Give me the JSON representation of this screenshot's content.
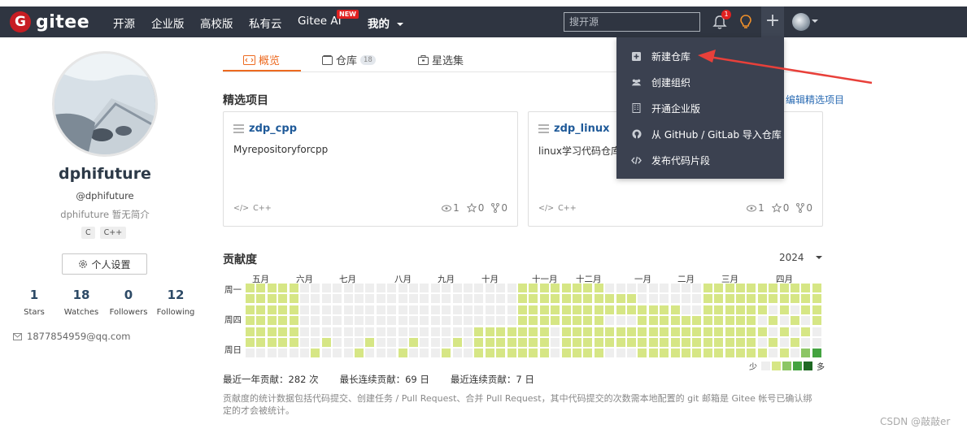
{
  "brand": {
    "logo_letter": "G",
    "name": "gitee"
  },
  "nav": {
    "items": [
      "开源",
      "企业版",
      "高校版",
      "私有云",
      "Gitee AI",
      "我的"
    ],
    "new_badge": "NEW",
    "search_placeholder": "搜开源",
    "notification_count": "1"
  },
  "profile": {
    "name": "dphifuture",
    "handle": "@dphifuture",
    "bio": "dphifuture 暂无简介",
    "languages": [
      "C",
      "C++"
    ],
    "settings_label": "个人设置",
    "stats": [
      {
        "value": "1",
        "label": "Stars"
      },
      {
        "value": "18",
        "label": "Watches"
      },
      {
        "value": "0",
        "label": "Followers"
      },
      {
        "value": "12",
        "label": "Following"
      }
    ],
    "email": "1877854959@qq.com"
  },
  "tabs": [
    {
      "label": "概览",
      "count": ""
    },
    {
      "label": "仓库",
      "count": "18"
    },
    {
      "label": "星选集",
      "count": ""
    }
  ],
  "featured": {
    "title": "精选项目",
    "edit_label": "编辑精选项目",
    "projects": [
      {
        "name": "zdp_cpp",
        "description": "Myrepositoryforcpp",
        "language": "C++",
        "watches": "1",
        "stars": "0",
        "forks": "0"
      },
      {
        "name": "zdp_linux",
        "description": "linux学习代码仓库",
        "language": "C++",
        "watches": "1",
        "stars": "0",
        "forks": "0"
      }
    ]
  },
  "contribution": {
    "title": "贡献度",
    "year": "2024",
    "months": [
      "五月",
      "六月",
      "七月",
      "八月",
      "九月",
      "十月",
      "十一月",
      "十二月",
      "一月",
      "二月",
      "三月",
      "四月"
    ],
    "day_labels": [
      "周一",
      "周四",
      "周日"
    ],
    "legend_less": "少",
    "legend_more": "多",
    "colors": [
      "#eeeeee",
      "#d6e685",
      "#8cc665",
      "#44a340",
      "#1e6823"
    ],
    "summary": [
      "最近一年贡献：282 次",
      "最长连续贡献：69 日",
      "最近连续贡献：7 日"
    ],
    "note": "贡献度的统计数据包括代码提交、创建任务 / Pull Request、合并 Pull Request，其中代码提交的次数需本地配置的 git 邮箱是 Gitee 帐号已确认绑定的才会被统计。"
  },
  "dropdown": {
    "items": [
      {
        "label": "新建仓库",
        "icon": "plus-square-icon"
      },
      {
        "label": "创建组织",
        "icon": "users-icon"
      },
      {
        "label": "开通企业版",
        "icon": "building-icon"
      },
      {
        "label": "从 GitHub / GitLab 导入仓库",
        "icon": "github-icon"
      },
      {
        "label": "发布代码片段",
        "icon": "code-icon"
      }
    ]
  },
  "watermark": "CSDN @敲敲er"
}
